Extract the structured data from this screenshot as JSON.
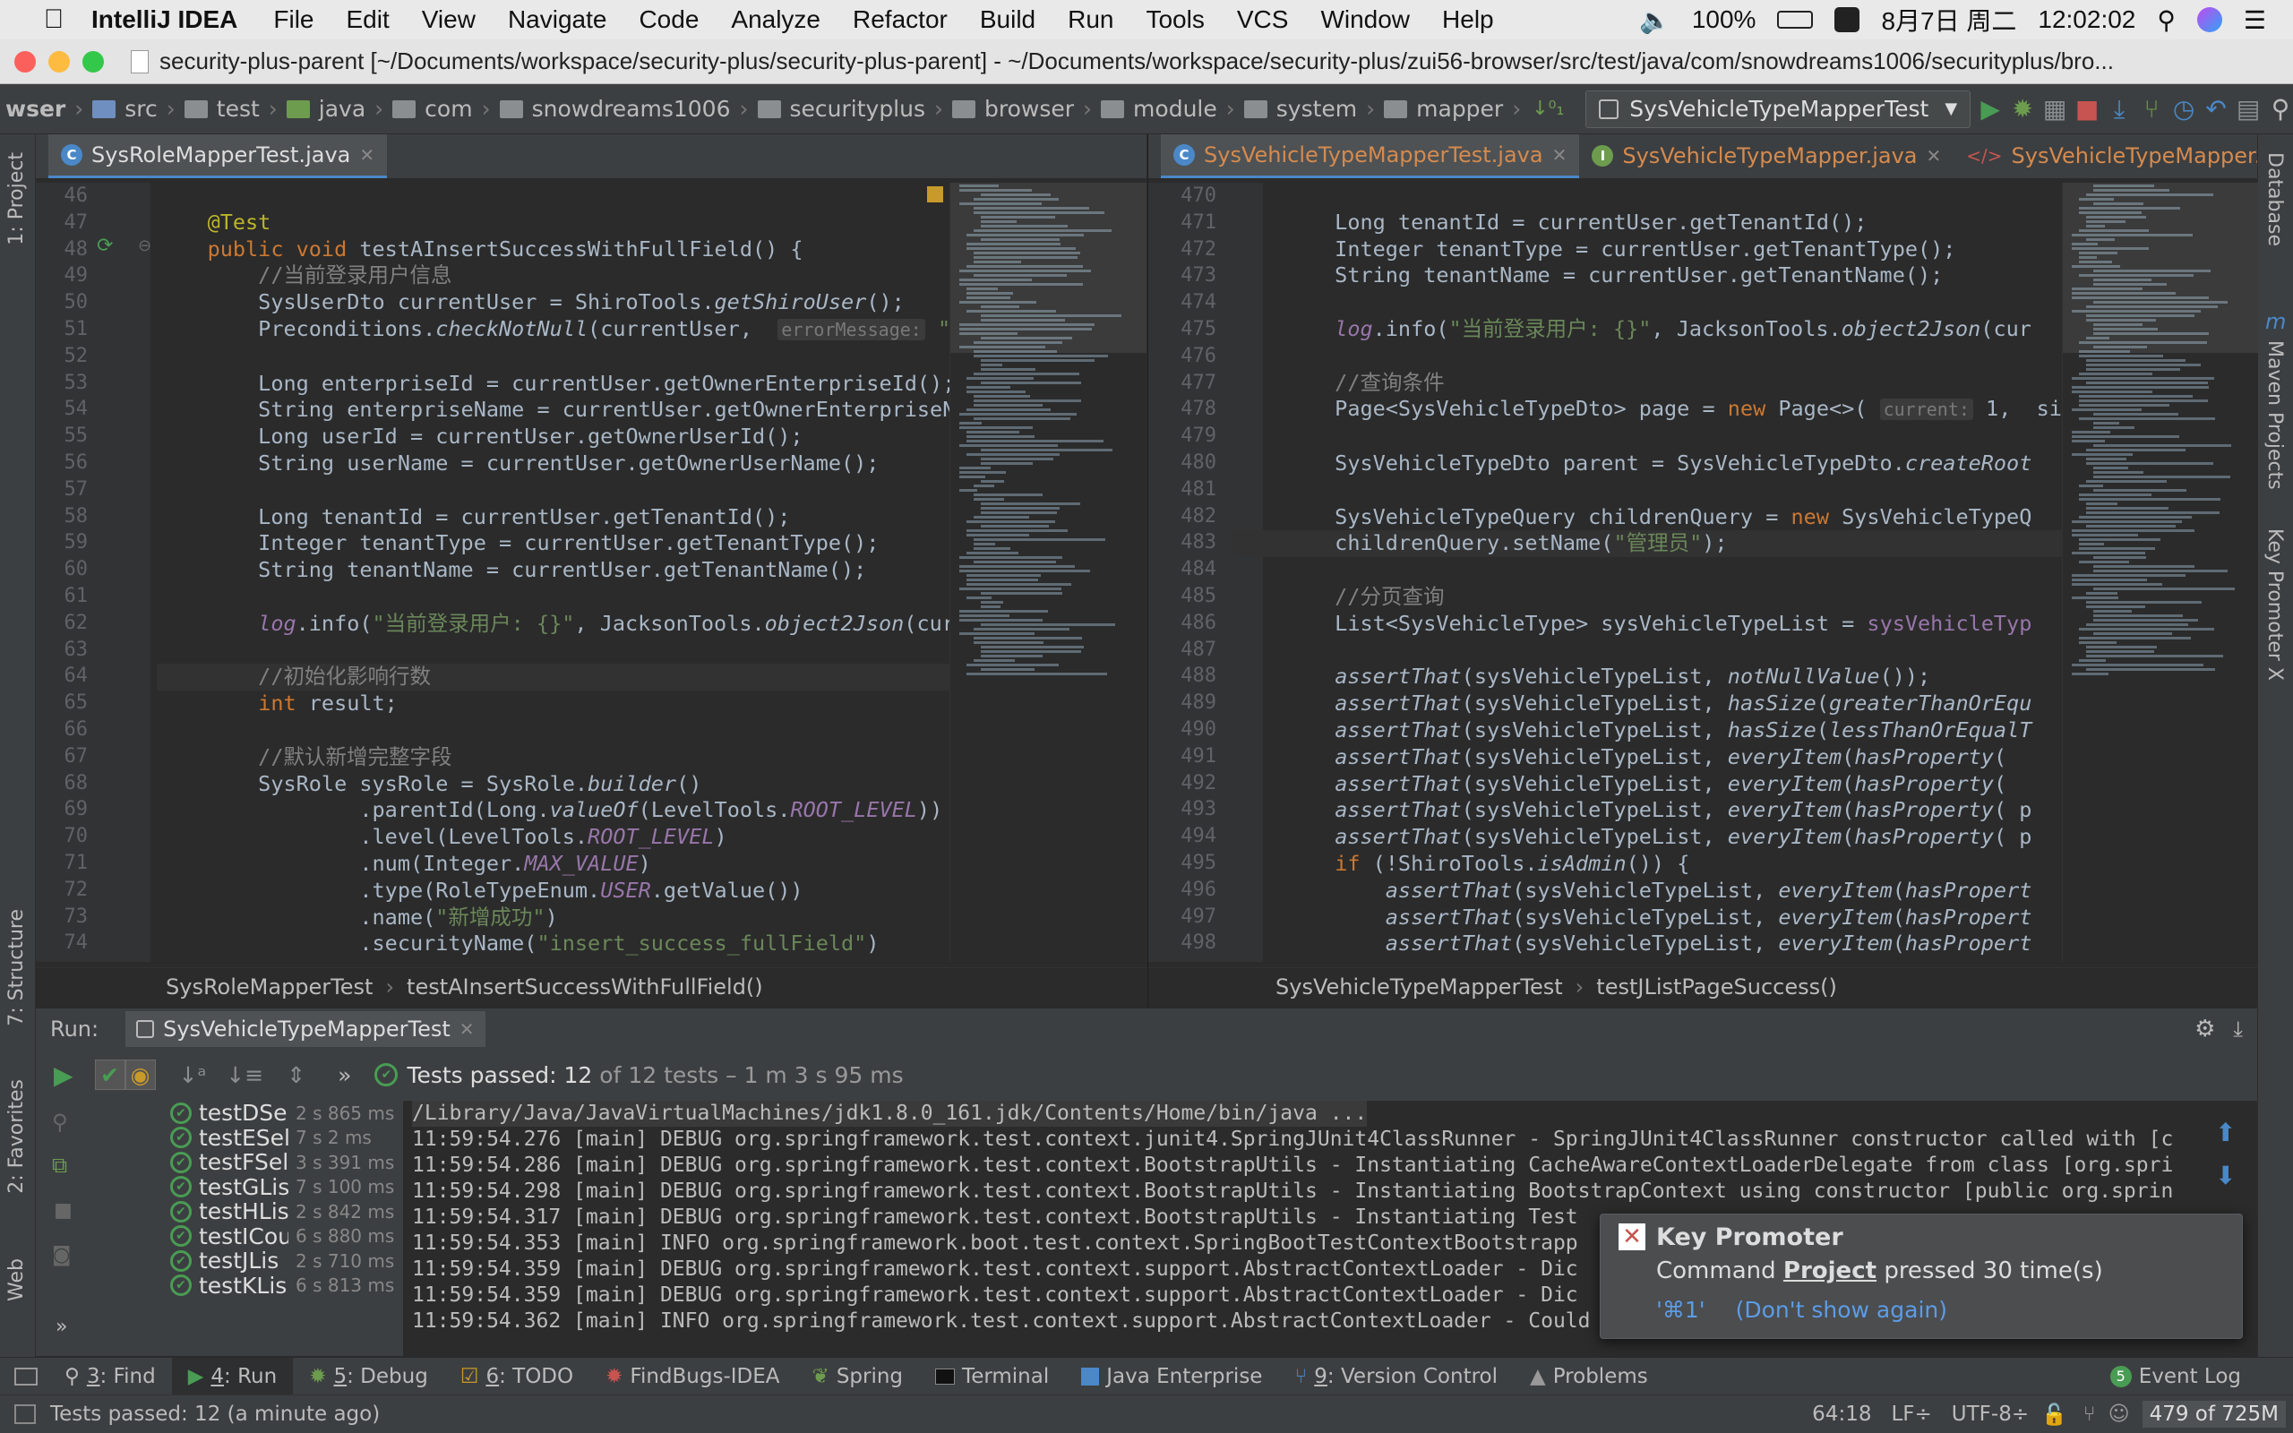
{
  "menubar": {
    "app_name": "IntelliJ IDEA",
    "items": [
      "File",
      "Edit",
      "View",
      "Navigate",
      "Code",
      "Analyze",
      "Refactor",
      "Build",
      "Run",
      "Tools",
      "VCS",
      "Window",
      "Help"
    ],
    "battery": "100%",
    "date": "8月7日 周二",
    "time": "12:02:02"
  },
  "window": {
    "title": "security-plus-parent [~/Documents/workspace/security-plus/security-plus-parent] - ~/Documents/workspace/security-plus/zui56-browser/src/test/java/com/snowdreams1006/securityplus/bro..."
  },
  "navbar": {
    "crumbs": [
      "wser",
      "src",
      "test",
      "java",
      "com",
      "snowdreams1006",
      "securityplus",
      "browser",
      "module",
      "system",
      "mapper"
    ],
    "run_config": "SysVehicleTypeMapperTest"
  },
  "sidebars": {
    "left": [
      "1: Project",
      "7: Structure",
      "2: Favorites",
      "Web"
    ],
    "right": [
      "Database",
      "Maven Projects",
      "Key Promoter X"
    ]
  },
  "left_editor": {
    "tab": "SysRoleMapperTest.java",
    "lines": [
      {
        "n": "46",
        "t": ""
      },
      {
        "n": "47",
        "t": "    @Test"
      },
      {
        "n": "48",
        "t": "    public void testAInsertSuccessWithFullField() {"
      },
      {
        "n": "49",
        "t": "        //当前登录用户信息"
      },
      {
        "n": "50",
        "t": "        SysUserDto currentUser = ShiroTools.getShiroUser();"
      },
      {
        "n": "51",
        "t": "        Preconditions.checkNotNull(currentUser,  errorMessage: \"当"
      },
      {
        "n": "52",
        "t": ""
      },
      {
        "n": "53",
        "t": "        Long enterpriseId = currentUser.getOwnerEnterpriseId();"
      },
      {
        "n": "54",
        "t": "        String enterpriseName = currentUser.getOwnerEnterpriseN"
      },
      {
        "n": "55",
        "t": "        Long userId = currentUser.getOwnerUserId();"
      },
      {
        "n": "56",
        "t": "        String userName = currentUser.getOwnerUserName();"
      },
      {
        "n": "57",
        "t": ""
      },
      {
        "n": "58",
        "t": "        Long tenantId = currentUser.getTenantId();"
      },
      {
        "n": "59",
        "t": "        Integer tenantType = currentUser.getTenantType();"
      },
      {
        "n": "60",
        "t": "        String tenantName = currentUser.getTenantName();"
      },
      {
        "n": "61",
        "t": ""
      },
      {
        "n": "62",
        "t": "        log.info(\"当前登录用户: {}\", JacksonTools.object2Json(cur"
      },
      {
        "n": "63",
        "t": ""
      },
      {
        "n": "64",
        "t": "        //初始化影响行数"
      },
      {
        "n": "65",
        "t": "        int result;"
      },
      {
        "n": "66",
        "t": ""
      },
      {
        "n": "67",
        "t": "        //默认新增完整字段"
      },
      {
        "n": "68",
        "t": "        SysRole sysRole = SysRole.builder()"
      },
      {
        "n": "69",
        "t": "                .parentId(Long.valueOf(LevelTools.ROOT_LEVEL))"
      },
      {
        "n": "70",
        "t": "                .level(LevelTools.ROOT_LEVEL)"
      },
      {
        "n": "71",
        "t": "                .num(Integer.MAX_VALUE)"
      },
      {
        "n": "72",
        "t": "                .type(RoleTypeEnum.USER.getValue())"
      },
      {
        "n": "73",
        "t": "                .name(\"新增成功\")"
      },
      {
        "n": "74",
        "t": "                .securityName(\"insert_success_fullField\")"
      }
    ],
    "breadcrumb": [
      "SysRoleMapperTest",
      "testAInsertSuccessWithFullField()"
    ]
  },
  "right_editor": {
    "tabs": [
      "SysVehicleTypeMapperTest.java",
      "SysVehicleTypeMapper.java",
      "SysVehicleTypeMapper.xml"
    ],
    "lines": [
      {
        "n": "470",
        "t": ""
      },
      {
        "n": "471",
        "t": "        Long tenantId = currentUser.getTenantId();"
      },
      {
        "n": "472",
        "t": "        Integer tenantType = currentUser.getTenantType();"
      },
      {
        "n": "473",
        "t": "        String tenantName = currentUser.getTenantName();"
      },
      {
        "n": "474",
        "t": ""
      },
      {
        "n": "475",
        "t": "        log.info(\"当前登录用户: {}\", JacksonTools.object2Json(cur"
      },
      {
        "n": "476",
        "t": ""
      },
      {
        "n": "477",
        "t": "        //查询条件"
      },
      {
        "n": "478",
        "t": "        Page<SysVehicleTypeDto> page = new Page<>( current: 1,  si"
      },
      {
        "n": "479",
        "t": ""
      },
      {
        "n": "480",
        "t": "        SysVehicleTypeDto parent = SysVehicleTypeDto.createRoot"
      },
      {
        "n": "481",
        "t": ""
      },
      {
        "n": "482",
        "t": "        SysVehicleTypeQuery childrenQuery = new SysVehicleTypeQ"
      },
      {
        "n": "483",
        "t": "        childrenQuery.setName(\"管理员\");"
      },
      {
        "n": "484",
        "t": ""
      },
      {
        "n": "485",
        "t": "        //分页查询"
      },
      {
        "n": "486",
        "t": "        List<SysVehicleType> sysVehicleTypeList = sysVehicleTyp"
      },
      {
        "n": "487",
        "t": ""
      },
      {
        "n": "488",
        "t": "        assertThat(sysVehicleTypeList, notNullValue());"
      },
      {
        "n": "489",
        "t": "        assertThat(sysVehicleTypeList, hasSize(greaterThanOrEqu"
      },
      {
        "n": "490",
        "t": "        assertThat(sysVehicleTypeList, hasSize(lessThanOrEqualT"
      },
      {
        "n": "491",
        "t": "        assertThat(sysVehicleTypeList, everyItem(hasProperty("
      },
      {
        "n": "492",
        "t": "        assertThat(sysVehicleTypeList, everyItem(hasProperty("
      },
      {
        "n": "493",
        "t": "        assertThat(sysVehicleTypeList, everyItem(hasProperty( p"
      },
      {
        "n": "494",
        "t": "        assertThat(sysVehicleTypeList, everyItem(hasProperty( p"
      },
      {
        "n": "495",
        "t": "        if (!ShiroTools.isAdmin()) {"
      },
      {
        "n": "496",
        "t": "            assertThat(sysVehicleTypeList, everyItem(hasPropert"
      },
      {
        "n": "497",
        "t": "            assertThat(sysVehicleTypeList, everyItem(hasPropert"
      },
      {
        "n": "498",
        "t": "            assertThat(sysVehicleTypeList, everyItem(hasPropert"
      }
    ],
    "breadcrumb": [
      "SysVehicleTypeMapperTest",
      "testJListPageSuccess()"
    ]
  },
  "run_panel": {
    "label": "Run:",
    "tab": "SysVehicleTypeMapperTest",
    "status_prefix": "Tests passed:",
    "status_count": "12",
    "status_rest": "of 12 tests – 1 m 3 s 95 ms",
    "tests": [
      {
        "name": "testDSe",
        "time": "2 s 865 ms"
      },
      {
        "name": "testESelec",
        "time": "7 s 2 ms"
      },
      {
        "name": "testFSel",
        "time": "3 s 391 ms"
      },
      {
        "name": "testGLis",
        "time": "7 s 100 ms"
      },
      {
        "name": "testHLis",
        "time": "2 s 842 ms"
      },
      {
        "name": "testICou",
        "time": "6 s 880 ms"
      },
      {
        "name": "testJLis",
        "time": "2 s 710 ms"
      },
      {
        "name": "testKLis",
        "time": "6 s 813 ms"
      }
    ],
    "console": [
      "/Library/Java/JavaVirtualMachines/jdk1.8.0_161.jdk/Contents/Home/bin/java ...",
      "11:59:54.276 [main] DEBUG org.springframework.test.context.junit4.SpringJUnit4ClassRunner - SpringJUnit4ClassRunner constructor called with [c",
      "11:59:54.286 [main] DEBUG org.springframework.test.context.BootstrapUtils - Instantiating CacheAwareContextLoaderDelegate from class [org.spri",
      "11:59:54.298 [main] DEBUG org.springframework.test.context.BootstrapUtils - Instantiating BootstrapContext using constructor [public org.sprin",
      "11:59:54.317 [main] DEBUG org.springframework.test.context.BootstrapUtils - Instantiating Test",
      "11:59:54.353 [main] INFO org.springframework.boot.test.context.SpringBootTestContextBootstrapp",
      "11:59:54.359 [main] DEBUG org.springframework.test.context.support.AbstractContextLoader - Dic",
      "11:59:54.359 [main] DEBUG org.springframework.test.context.support.AbstractContextLoader - Dic",
      "11:59:54.362 [main] INFO org.springframework.test.context.support.AbstractContextLoader - Could not detect default resource locations for tes"
    ]
  },
  "popup": {
    "title": "Key Promoter",
    "text_prefix": "Command",
    "command": "Project",
    "text_suffix": "pressed 30 time(s)",
    "shortcut": "'⌘1'",
    "dismiss": "(Don't show again)"
  },
  "tool_windows": [
    {
      "num": "3",
      "label": ": Find"
    },
    {
      "num": "4",
      "label": ": Run"
    },
    {
      "num": "5",
      "label": ": Debug"
    },
    {
      "num": "6",
      "label": ": TODO"
    },
    {
      "num": "",
      "label": "FindBugs-IDEA"
    },
    {
      "num": "",
      "label": "Spring"
    },
    {
      "num": "",
      "label": "Terminal"
    },
    {
      "num": "",
      "label": "Java Enterprise"
    },
    {
      "num": "9",
      "label": ": Version Control"
    },
    {
      "num": "",
      "label": "Problems"
    }
  ],
  "event_log": {
    "count": "5",
    "label": "Event Log"
  },
  "status_bar": {
    "message": "Tests passed: 12 (a minute ago)",
    "position": "64:18",
    "line_sep": "LF÷",
    "encoding": "UTF-8÷",
    "memory": "479 of 725M"
  },
  "colors": {
    "accent": "#4a88c7",
    "pass": "#499c54",
    "keyword": "#cc7832",
    "string": "#6a8759",
    "comment": "#808080"
  }
}
